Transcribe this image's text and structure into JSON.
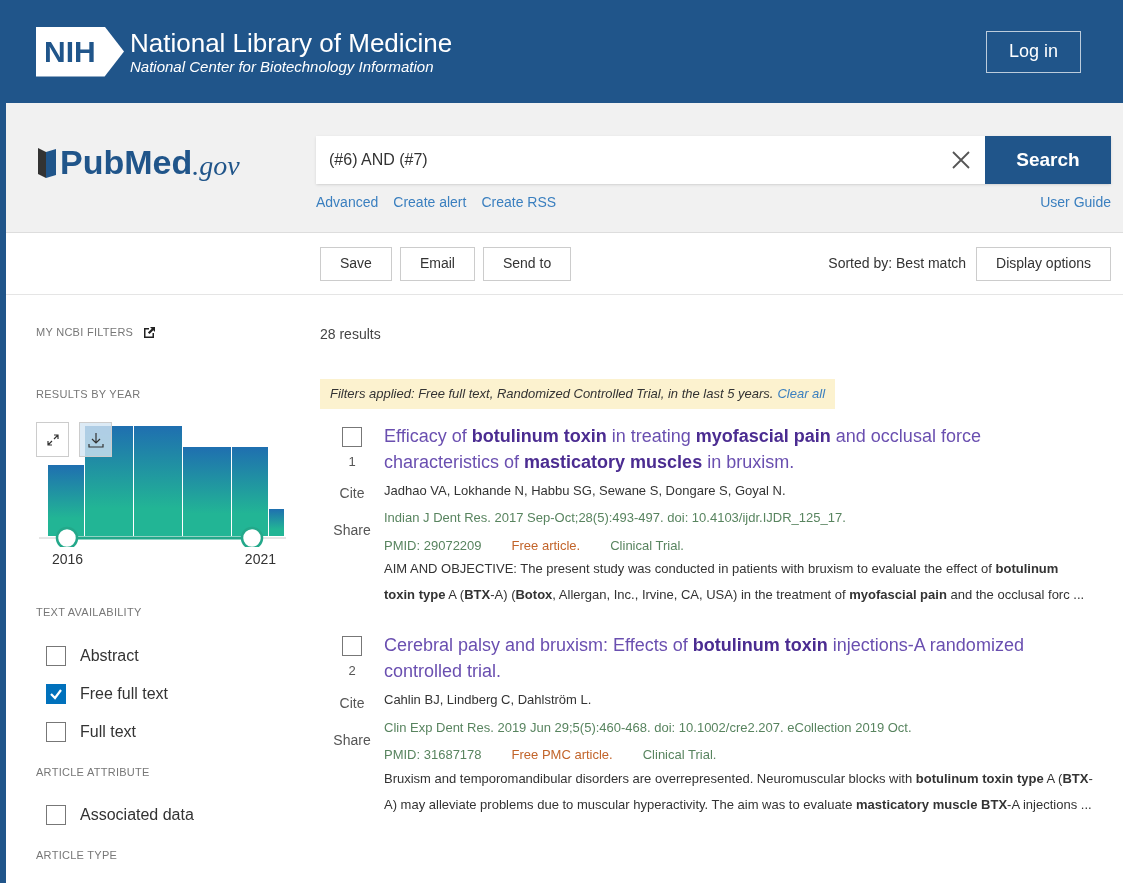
{
  "header": {
    "logo": "NIH",
    "title": "National Library of Medicine",
    "subtitle": "National Center for Biotechnology Information",
    "login_button": "Log in"
  },
  "search": {
    "brand": "PubMed",
    "brand_suffix": ".gov",
    "query": "(#6) AND (#7)",
    "button": "Search",
    "links": [
      "Advanced",
      "Create alert",
      "Create RSS"
    ],
    "user_guide": "User Guide"
  },
  "toolbar": {
    "buttons": [
      "Save",
      "Email",
      "Send to"
    ],
    "sort_label": "Sorted by: Best match",
    "display_button": "Display options"
  },
  "sidebar": {
    "my_filters": "MY NCBI FILTERS",
    "results_by_year": "RESULTS BY YEAR",
    "year_start": "2016",
    "year_end": "2021",
    "sections": [
      {
        "heading": "TEXT AVAILABILITY",
        "options": [
          {
            "label": "Abstract",
            "checked": false
          },
          {
            "label": "Free full text",
            "checked": true
          },
          {
            "label": "Full text",
            "checked": false
          }
        ]
      },
      {
        "heading": "ARTICLE ATTRIBUTE",
        "options": [
          {
            "label": "Associated data",
            "checked": false
          }
        ]
      },
      {
        "heading": "ARTICLE TYPE"
      }
    ]
  },
  "results": {
    "count": "28 results",
    "filters_text": "Filters applied: Free full text, Randomized Controlled Trial, in the last 5 years.",
    "clear_all": "Clear all",
    "articles": [
      {
        "number": "1",
        "checked": false,
        "title": "Efficacy of **botulinum toxin** in treating **myofascial pain** and occlusal force characteristics of **masticatory muscles** in bruxism.",
        "authors": "Jadhao VA, Lokhande N, Habbu SG, Sewane S, Dongare S, Goyal N.",
        "citation": "Indian J Dent Res. 2017 Sep-Oct;28(5):493-497. doi: 10.4103/ijdr.IJDR_125_17.",
        "pmid": "PMID: 29072209",
        "free": "Free article.",
        "type": "Clinical Trial.",
        "snippet": "AIM AND OBJECTIVE: The present study was conducted in patients with bruxism to evaluate the effect of **botulinum toxin type** A (**BTX**-A) (**Botox**, Allergan, Inc., Irvine, CA, USA) in the treatment of **myofascial pain** and the occlusal forc ...",
        "cite": "Cite",
        "share": "Share"
      },
      {
        "number": "2",
        "checked": false,
        "title": "Cerebral palsy and bruxism: Effects of **botulinum toxin** injections-A randomized controlled trial.",
        "authors": "Cahlin BJ, Lindberg C, Dahlström L.",
        "citation": "Clin Exp Dent Res. 2019 Jun 29;5(5):460-468. doi: 10.1002/cre2.207. eCollection 2019 Oct.",
        "pmid": "PMID: 31687178",
        "free": "Free PMC article.",
        "type": "Clinical Trial.",
        "snippet": "Bruxism and temporomandibular disorders are overrepresented. Neuromuscular blocks with **botulinum toxin type** A (**BTX**-A) may alleviate problems due to muscular hyperactivity. The aim was to evaluate **masticatory muscle BTX**-A injections ...",
        "cite": "Cite",
        "share": "Share"
      }
    ]
  }
}
